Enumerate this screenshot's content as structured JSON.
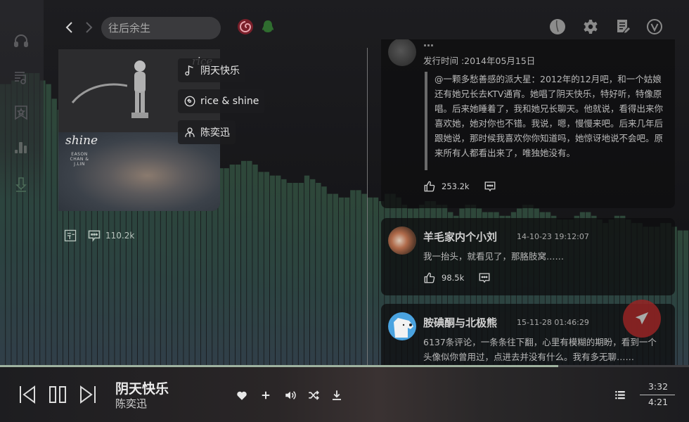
{
  "app": {
    "accent_color": "#9fb29f",
    "fab_color": "#962424"
  },
  "sidebar": {
    "items": [
      {
        "name": "headphones",
        "icon": "headphones-icon"
      },
      {
        "name": "playlist",
        "icon": "music-list-icon"
      },
      {
        "name": "favorites",
        "icon": "star-bookmark-icon"
      },
      {
        "name": "charts",
        "icon": "bar-chart-icon"
      },
      {
        "name": "download",
        "icon": "download-icon"
      }
    ]
  },
  "topbar": {
    "back_icon": "chevron-left-icon",
    "forward_icon": "chevron-right-icon",
    "search_value": "往后余生",
    "source_icons": [
      "netease-music-icon",
      "qq-music-icon"
    ],
    "right_icons": [
      "user-avatar-icon",
      "gear-icon",
      "notes-edit-icon",
      "vip-icon"
    ]
  },
  "album": {
    "cover_text_top": "rice",
    "cover_text_bottom": "shine",
    "cover_subtext": "EASON CHAN & J.LIN",
    "song_chip": "阴天快乐",
    "album_chip": "rice & shine",
    "artist_chip": "陈奕迅",
    "comment_count": "110.2k"
  },
  "comments": [
    {
      "user": "…",
      "time": "",
      "release_label": "发行时间 :2014年05月15日",
      "quote": "@一颗多愁善感的派大星：2012年的12月吧，和一个姑娘还有她兄长去KTV通宵。她唱了阴天快乐，特好听，特像原唱。后来她睡着了，我和她兄长聊天。他就说，看得出来你喜欢她，她对你也不错。我说，嗯，慢慢来吧。后来几年后跟她说，那时候我喜欢你你知道吗，她惊讶地说不会吧。原来所有人都看出来了，唯独她没有。",
      "likes": "253.2k"
    },
    {
      "user": "羊毛家内个小刘",
      "time": "14-10-23 19:12:07",
      "text": "我一抬头，就看见了，那胳肢窝……",
      "likes": "98.5k"
    },
    {
      "user": "胺碘酮与北极熊",
      "time": "15-11-28 01:46:29",
      "text": "6137条评论，一条条往下翻，心里有模糊的期盼，看到一个头像似你曾用过，点进去并没有什么。我有多无聊……"
    }
  ],
  "player": {
    "title": "阴天快乐",
    "artist": "陈奕迅",
    "current_time": "3:32",
    "total_time": "4:21",
    "progress": 0.81,
    "controls": [
      "previous-icon",
      "pause-icon",
      "next-icon"
    ],
    "actions": [
      "heart-icon",
      "plus-icon",
      "volume-icon",
      "shuffle-icon",
      "download-icon"
    ],
    "playlist_icon": "playlist-icon"
  },
  "visualizer": {
    "levels": [
      0.77,
      0.77,
      0.78,
      0.78,
      0.8,
      0.8,
      0.8,
      0.78,
      0.77,
      0.73,
      0.7,
      0.69,
      0.69,
      0.7,
      0.7,
      0.69,
      0.69,
      0.68,
      0.67,
      0.65,
      0.65,
      0.65,
      0.64,
      0.63,
      0.63,
      0.62,
      0.63,
      0.61,
      0.6,
      0.58,
      0.58,
      0.59,
      0.58,
      0.57,
      0.56,
      0.56,
      0.57,
      0.56,
      0.54,
      0.54,
      0.55,
      0.55,
      0.56,
      0.56,
      0.55,
      0.53,
      0.53,
      0.52,
      0.52,
      0.51,
      0.5,
      0.5,
      0.5,
      0.52,
      0.51,
      0.5,
      0.49,
      0.47,
      0.47,
      0.46,
      0.46,
      0.48,
      0.48,
      0.47,
      0.46,
      0.46,
      0.45,
      0.47,
      0.47,
      0.46,
      0.44,
      0.43,
      0.43,
      0.44,
      0.45,
      0.45,
      0.44,
      0.44,
      0.42,
      0.41,
      0.43,
      0.44,
      0.44,
      0.43,
      0.42,
      0.42,
      0.42,
      0.41,
      0.41,
      0.42,
      0.43,
      0.44,
      0.44,
      0.43,
      0.42,
      0.42,
      0.41,
      0.4,
      0.4,
      0.4,
      0.41,
      0.42,
      0.42,
      0.41,
      0.4,
      0.39,
      0.4,
      0.41,
      0.41,
      0.4,
      0.39,
      0.39,
      0.38,
      0.38,
      0.38,
      0.39,
      0.39,
      0.38,
      0.37,
      0.37
    ]
  }
}
